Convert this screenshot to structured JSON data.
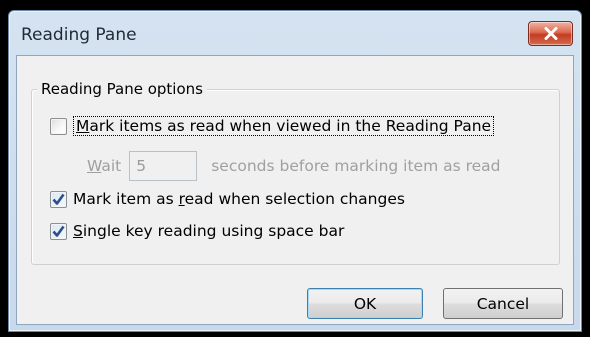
{
  "window": {
    "title": "Reading Pane"
  },
  "group": {
    "legend": "Reading Pane options"
  },
  "options": {
    "mark_viewed": {
      "label_pre": "",
      "label_u": "M",
      "label_post": "ark items as read when viewed in the Reading Pane",
      "checked": false
    },
    "wait": {
      "label_u": "W",
      "label_post": "ait",
      "value": "5",
      "suffix": "seconds before marking item as read"
    },
    "mark_selection": {
      "label_pre": "Mark item as ",
      "label_u": "r",
      "label_post": "ead when selection changes",
      "checked": true
    },
    "single_key": {
      "label_pre": "",
      "label_u": "S",
      "label_post": "ingle key reading using space bar",
      "checked": true
    }
  },
  "buttons": {
    "ok": "OK",
    "cancel": "Cancel"
  },
  "colors": {
    "title_bar": "#d5e3f1",
    "close_button": "#c23d22",
    "dialog_face": "#f0f0f0"
  }
}
